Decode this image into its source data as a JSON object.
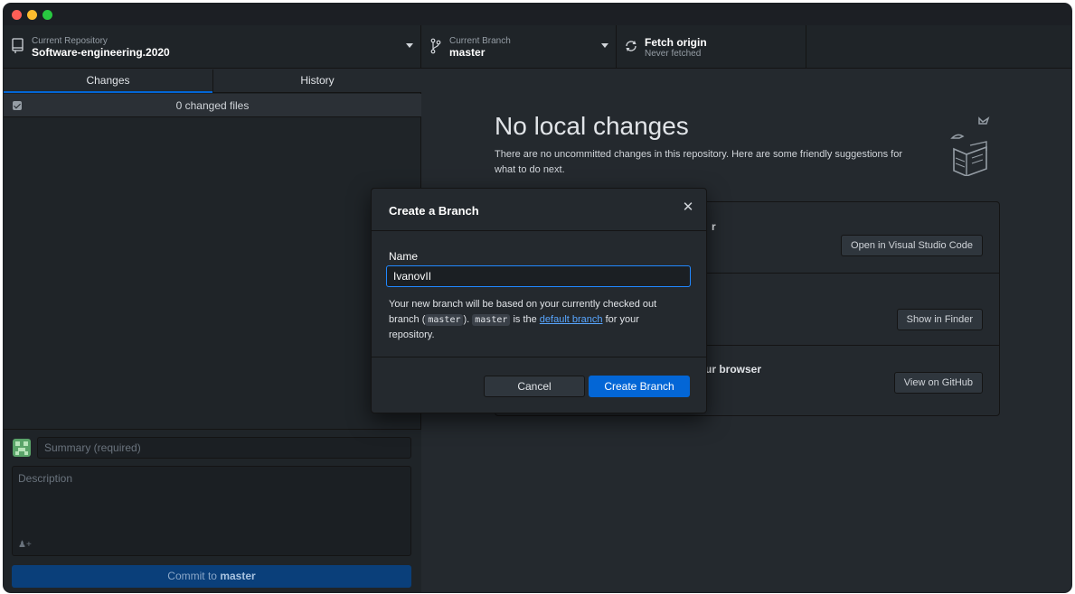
{
  "toolbar": {
    "repository": {
      "label": "Current Repository",
      "value": "Software-engineering.2020"
    },
    "branch": {
      "label": "Current Branch",
      "value": "master"
    },
    "fetch": {
      "label": "Fetch origin",
      "sub": "Never fetched"
    }
  },
  "sidebar": {
    "tabs": [
      {
        "label": "Changes",
        "active": true
      },
      {
        "label": "History",
        "active": false
      }
    ],
    "changed_files": "0 changed files",
    "commit": {
      "summary_placeholder": "Summary (required)",
      "description_placeholder": "Description",
      "button_prefix": "Commit to",
      "button_branch": "master"
    }
  },
  "main": {
    "title": "No local changes",
    "description": "There are no uncommitted changes in this repository. Here are some friendly suggestions for what to do next.",
    "suggestions": [
      {
        "title_visible": "r",
        "button": "Open in Visual Studio Code"
      },
      {
        "title_visible": "",
        "button": "Show in Finder"
      },
      {
        "title_visible": "ur browser",
        "button": "View on GitHub"
      }
    ]
  },
  "dialog": {
    "title": "Create a Branch",
    "name_label": "Name",
    "name_value": "IvanovII",
    "help_part1": "Your new branch will be based on your currently checked out branch (",
    "help_code1": "master",
    "help_part2": "). ",
    "help_code2": "master",
    "help_part3": " is the ",
    "help_link": "default branch",
    "help_part4": " for your repository.",
    "cancel_label": "Cancel",
    "create_label": "Create Branch"
  },
  "colors": {
    "accent": "#0366d6",
    "background": "#24292e",
    "sidebar": "#1f2428"
  }
}
